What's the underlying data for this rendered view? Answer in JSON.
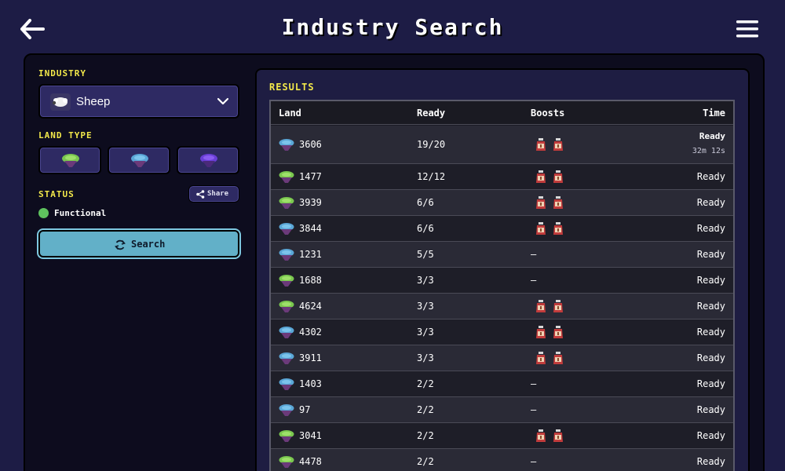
{
  "header": {
    "title": "Industry Search"
  },
  "sidebar": {
    "industry_label": "INDUSTRY",
    "industry_value": "Sheep",
    "land_type_label": "LAND TYPE",
    "land_types": [
      "green",
      "blue",
      "purple"
    ],
    "status_label": "STATUS",
    "share_label": "Share",
    "status_value": "Functional",
    "search_label": "Search"
  },
  "results": {
    "label": "RESULTS",
    "columns": {
      "land": "Land",
      "ready": "Ready",
      "boosts": "Boosts",
      "time": "Time"
    },
    "rows": [
      {
        "land_type": "blue",
        "land": "3606",
        "ready": "19/20",
        "boosts": 2,
        "time": "Ready",
        "time_sub": "32m 12s"
      },
      {
        "land_type": "green",
        "land": "1477",
        "ready": "12/12",
        "boosts": 2,
        "time": "Ready"
      },
      {
        "land_type": "green",
        "land": "3939",
        "ready": "6/6",
        "boosts": 2,
        "time": "Ready"
      },
      {
        "land_type": "blue",
        "land": "3844",
        "ready": "6/6",
        "boosts": 2,
        "time": "Ready"
      },
      {
        "land_type": "blue",
        "land": "1231",
        "ready": "5/5",
        "boosts": 0,
        "boosts_text": "–",
        "time": "Ready"
      },
      {
        "land_type": "green",
        "land": "1688",
        "ready": "3/3",
        "boosts": 0,
        "boosts_text": "–",
        "time": "Ready"
      },
      {
        "land_type": "green",
        "land": "4624",
        "ready": "3/3",
        "boosts": 2,
        "time": "Ready"
      },
      {
        "land_type": "blue",
        "land": "4302",
        "ready": "3/3",
        "boosts": 2,
        "time": "Ready"
      },
      {
        "land_type": "blue",
        "land": "3911",
        "ready": "3/3",
        "boosts": 2,
        "time": "Ready"
      },
      {
        "land_type": "blue",
        "land": "1403",
        "ready": "2/2",
        "boosts": 0,
        "boosts_text": "–",
        "time": "Ready"
      },
      {
        "land_type": "blue",
        "land": "97",
        "ready": "2/2",
        "boosts": 0,
        "boosts_text": "–",
        "time": "Ready"
      },
      {
        "land_type": "green",
        "land": "3041",
        "ready": "2/2",
        "boosts": 2,
        "time": "Ready"
      },
      {
        "land_type": "green",
        "land": "4478",
        "ready": "2/2",
        "boosts": 0,
        "boosts_text": "–",
        "time": "Ready"
      }
    ]
  },
  "colors": {
    "background": "#1d1c45",
    "accent_yellow": "#f2e84a",
    "search_button": "#62b0c8",
    "land_green": "#7ac74f",
    "land_blue": "#5aa6d6",
    "land_purple": "#6a3fd6",
    "status_functional": "#5ec25e"
  },
  "icons": {
    "back": "arrow-left-icon",
    "menu": "hamburger-menu-icon",
    "industry": "sheep-icon",
    "dropdown": "chevron-down-icon",
    "share": "share-icon",
    "search": "refresh-icon",
    "boost": "boost-potion-icon"
  }
}
